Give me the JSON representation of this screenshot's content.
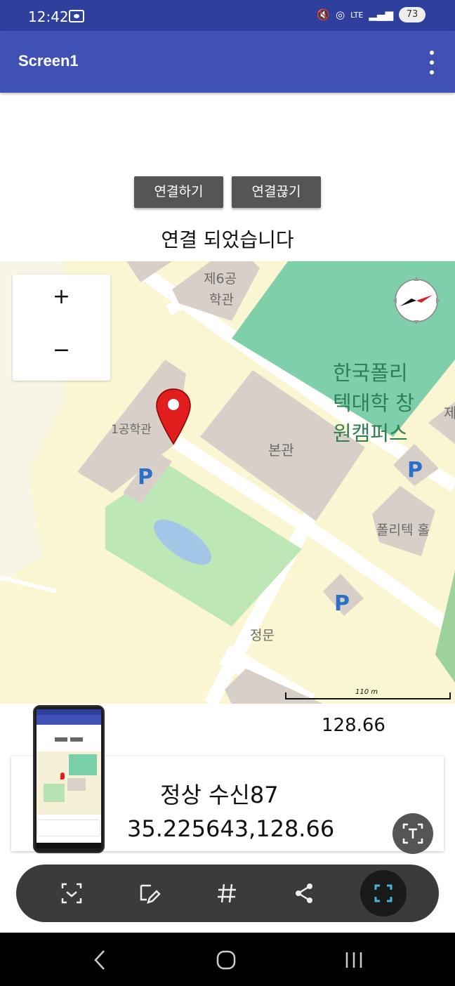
{
  "status_bar": {
    "time": "12:42",
    "network": "LTE",
    "battery": "73",
    "icons": [
      "screenshot-icon",
      "mute-icon",
      "hotspot-icon",
      "lte-icon",
      "signal-icon",
      "battery-icon"
    ]
  },
  "app_bar": {
    "title": "Screen1",
    "menu_icon": "more-vert-icon"
  },
  "buttons": {
    "connect": "연결하기",
    "disconnect": "연결끊기"
  },
  "connection_status": "연결 되었습니다",
  "map": {
    "zoom_in": "+",
    "zoom_out": "−",
    "labels": {
      "building6": "제6공",
      "building6b": "학관",
      "campus1": "한국폴리",
      "campus2": "텍대학 창",
      "campus3": "원캠퍼스",
      "building1": "1공학관",
      "main": "본관",
      "polytech_hall": "폴리텍 홀",
      "gate": "정문",
      "parking": "P",
      "edge": "제"
    },
    "scale_label": "110 m",
    "colors": {
      "background": "#f7f5e6",
      "campus": "#7fd0aa",
      "field": "#bde8b5",
      "building": "#d8d0c8",
      "road": "#ffffff",
      "pin": "#e11d1d"
    }
  },
  "longitude_text": "128.66",
  "card": {
    "line1": "정상 수신87",
    "line2": "35.225643,128.66"
  },
  "thumbnail": {
    "title": "Screen1"
  },
  "toolbar": {
    "items": [
      "scan-icon",
      "edit-icon",
      "hashtag-icon",
      "share-icon",
      "capture-icon"
    ]
  },
  "colors": {
    "status_bar": "#2f3f9e",
    "app_bar": "#3f51b5",
    "button": "#555555",
    "toolbar": "#3b3b3b",
    "capture_accent": "#3fb8e0"
  }
}
